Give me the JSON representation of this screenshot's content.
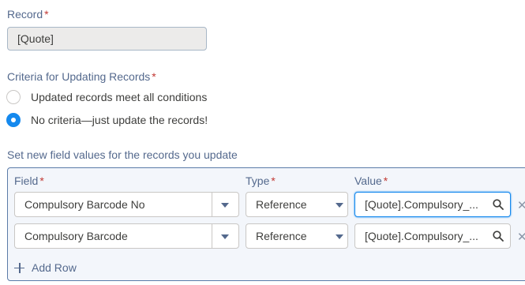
{
  "record": {
    "label": "Record",
    "required_mark": "*",
    "value": "[Quote]"
  },
  "criteria": {
    "label": "Criteria for Updating Records",
    "required_mark": "*",
    "options": [
      {
        "label": "Updated records meet all conditions",
        "selected": false
      },
      {
        "label": "No criteria—just update the records!",
        "selected": true
      }
    ]
  },
  "field_values": {
    "section_label": "Set new field values for the records you update",
    "columns": {
      "field": "Field",
      "type": "Type",
      "value": "Value",
      "required_mark": "*"
    },
    "rows": [
      {
        "field": "Compulsory Barcode No",
        "type": "Reference",
        "value": "[Quote].Compulsory_...",
        "focused": true
      },
      {
        "field": "Compulsory Barcode",
        "type": "Reference",
        "value": "[Quote].Compulsory_...",
        "focused": false
      }
    ],
    "add_row_label": "Add Row",
    "remove_glyph": "✕"
  },
  "colors": {
    "accent": "#1589ee",
    "label": "#54698d",
    "required": "#c23934"
  },
  "icons": [
    "search-icon",
    "chevron-down-icon",
    "close-icon",
    "add-icon"
  ]
}
